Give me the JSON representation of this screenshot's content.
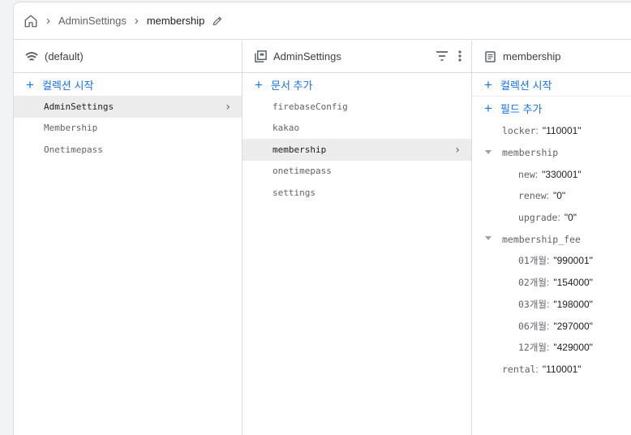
{
  "breadcrumb": {
    "items": [
      "AdminSettings",
      "membership"
    ]
  },
  "columns": {
    "database": {
      "title": "(default)",
      "add_label": "컬렉션 시작",
      "items": [
        "AdminSettings",
        "Membership",
        "Onetimepass"
      ],
      "selected_index": 0
    },
    "collection": {
      "title": "AdminSettings",
      "add_label": "문서 추가",
      "items": [
        "firebaseConfig",
        "kakao",
        "membership",
        "onetimepass",
        "settings"
      ],
      "selected_index": 2
    },
    "document": {
      "title": "membership",
      "add_collection_label": "컬렉션 시작",
      "add_field_label": "필드 추가",
      "fields": [
        {
          "key": "locker",
          "value": "\"110001\""
        },
        {
          "key": "membership",
          "children": [
            {
              "key": "new",
              "value": "\"330001\""
            },
            {
              "key": "renew",
              "value": "\"0\""
            },
            {
              "key": "upgrade",
              "value": "\"0\""
            }
          ]
        },
        {
          "key": "membership_fee",
          "children": [
            {
              "key": "01개월",
              "value": "\"990001\""
            },
            {
              "key": "02개월",
              "value": "\"154000\""
            },
            {
              "key": "03개월",
              "value": "\"198000\""
            },
            {
              "key": "06개월",
              "value": "\"297000\""
            },
            {
              "key": "12개월",
              "value": "\"429000\""
            }
          ]
        },
        {
          "key": "rental",
          "value": "\"110001\""
        }
      ]
    }
  },
  "icons": {
    "home": "home-icon",
    "edit": "pencil-icon",
    "database": "database-icon",
    "collection": "collection-icon",
    "filter": "filter-icon",
    "more": "more-vert-icon",
    "document": "document-icon",
    "expand": "chevron-right-icon",
    "collapse": "caret-down-icon"
  },
  "colors": {
    "accent": "#1a73e8",
    "selected_bg": "#ececec",
    "border": "#dadce0"
  }
}
